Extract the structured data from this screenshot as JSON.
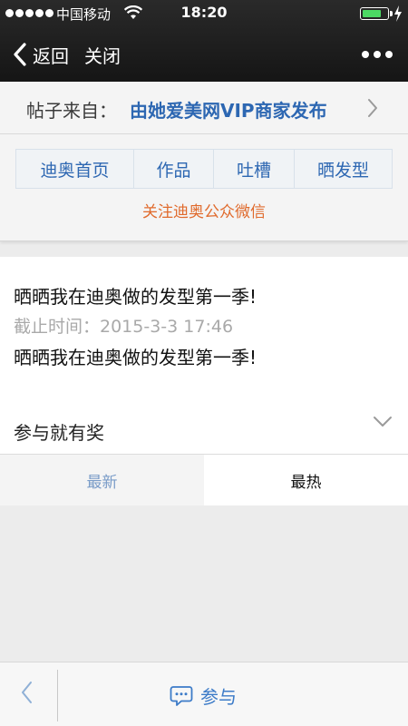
{
  "status_bar": {
    "carrier": "中国移动",
    "time": "18:20",
    "battery_level": 0.75,
    "signal_bars": 5
  },
  "nav": {
    "back_label": "返回",
    "close_label": "关闭"
  },
  "source": {
    "prefix": "帖子来自：",
    "name": "由她爱美网VIP商家发布"
  },
  "menu": {
    "tabs": [
      {
        "label": "迪奥首页"
      },
      {
        "label": "作品"
      },
      {
        "label": "吐槽"
      },
      {
        "label": "晒发型"
      }
    ],
    "follow_label": "关注迪奥公众微信"
  },
  "post": {
    "title": "晒晒我在迪奥做的发型第一季!",
    "deadline": "截止时间：2015-3-3 17:46",
    "body": "晒晒我在迪奥做的发型第一季!",
    "award_label": "参与就有奖"
  },
  "sort": {
    "latest": "最新",
    "hottest": "最热",
    "active": "hottest"
  },
  "bottom": {
    "join_label": "参与"
  },
  "colors": {
    "link_blue": "#2d67b2",
    "follow_orange": "#e06a2c",
    "battery_green": "#4cd964",
    "join_blue": "#3c7bc8"
  }
}
